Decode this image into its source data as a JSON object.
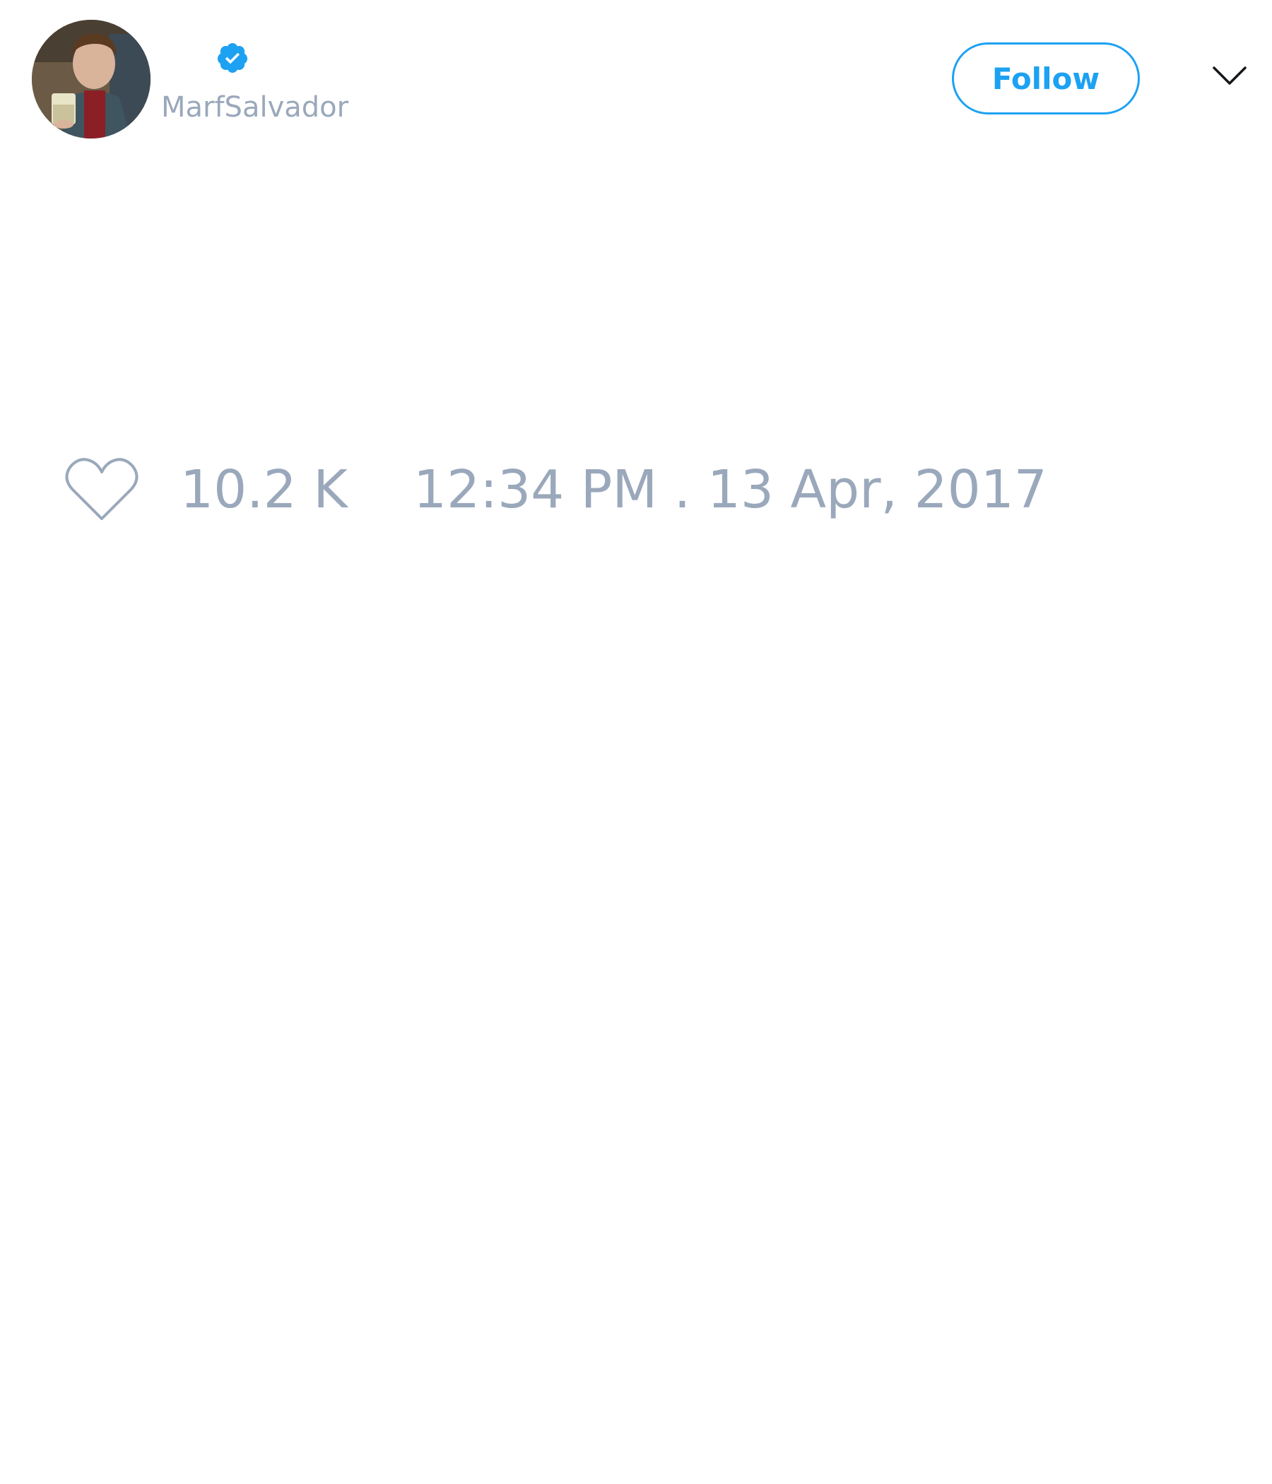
{
  "tweet": {
    "author": {
      "handle": "MarfSalvador",
      "verified": true,
      "avatar_icon": "user-avatar-photo"
    },
    "follow_label": "Follow",
    "menu_icon": "chevron-down-icon",
    "likes": {
      "icon": "heart-outline-icon",
      "count": "10.2 K"
    },
    "timestamp": "12:34 PM . 13 Apr, 2017"
  },
  "colors": {
    "accent": "#1da1f2",
    "muted_text": "#9aa8bb",
    "background": "#ffffff"
  }
}
